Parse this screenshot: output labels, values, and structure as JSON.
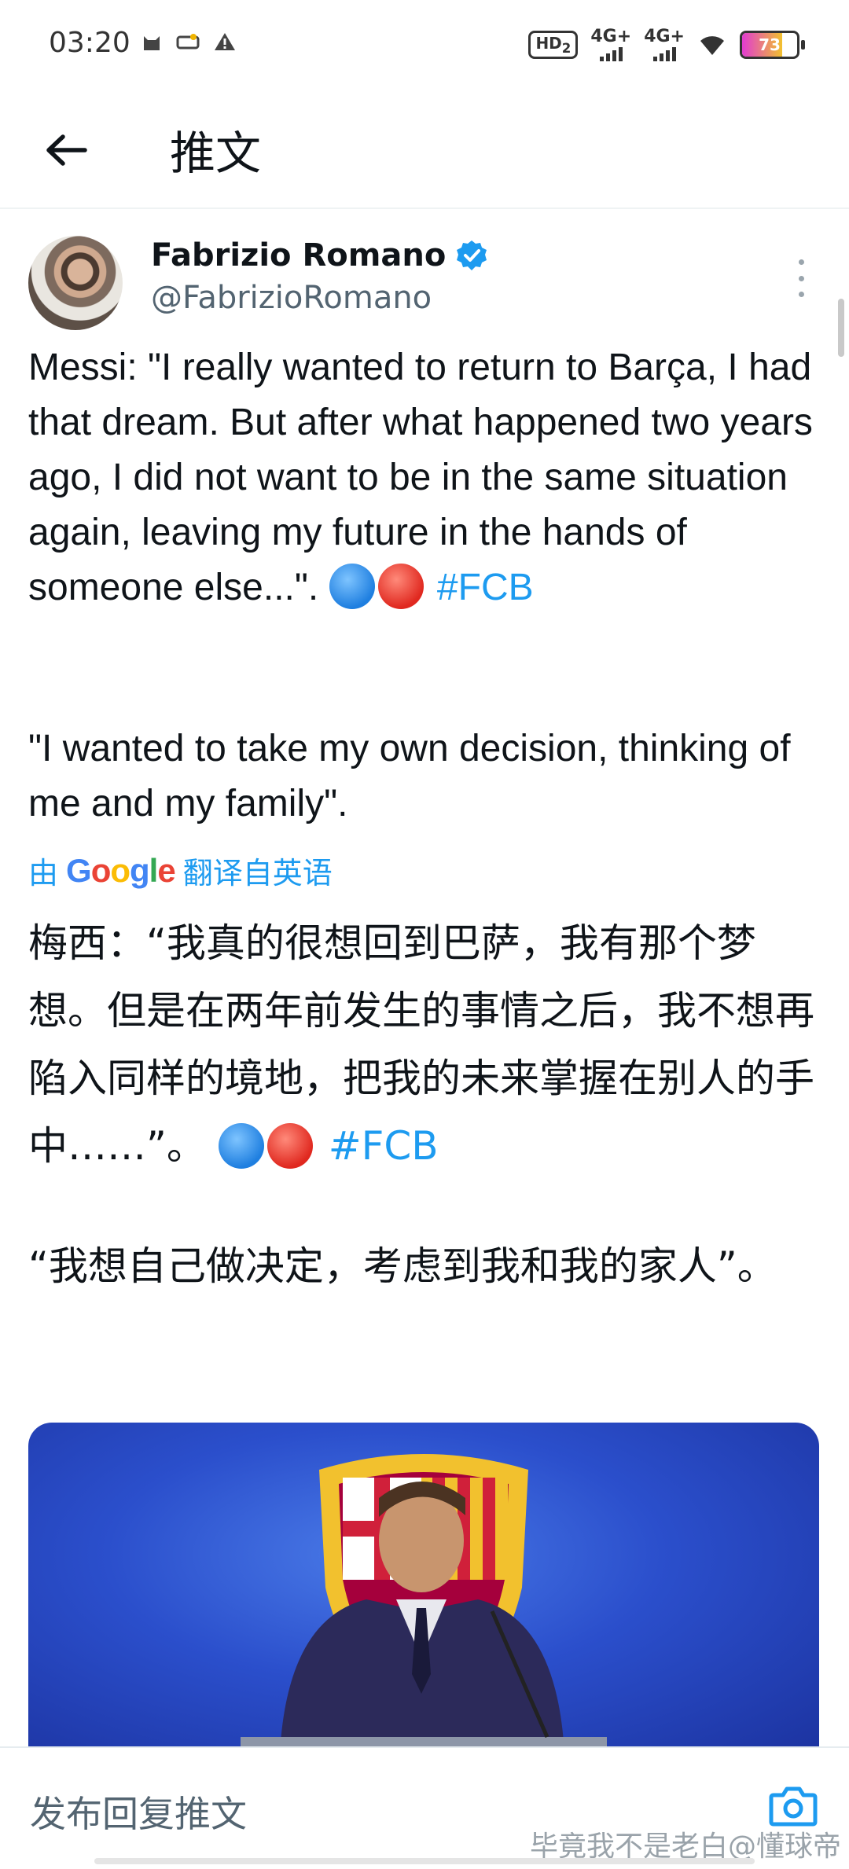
{
  "status_bar": {
    "time": "03:20",
    "hd_label": "HD",
    "hd_sub": "2",
    "net1": "4G+",
    "net2": "4G+",
    "battery": "73",
    "icons": [
      "cat-icon",
      "notification-icon",
      "warning-icon",
      "wifi-icon"
    ]
  },
  "header": {
    "title": "推文"
  },
  "tweet": {
    "author": "Fabrizio Romano",
    "handle": "@FabrizioRomano",
    "text_en_1": "Messi: \"I really wanted to return to Barça, I had that dream. But after what happened two years ago, I did not want to be in the same situation again, leaving my future in the hands of someone else...\".",
    "hashtag": "#FCB",
    "text_en_2": "\"I wanted to take my own decision, thinking of me and my family\".",
    "translate_prefix": "由",
    "translate_brand": "Google",
    "translate_suffix": "翻译自英语",
    "text_zh_1": "梅西：“我真的很想回到巴萨，我有那个梦想。但是在两年前发生的事情之后，我不想再陷入同样的境地，把我的未来掌握在别人的手中……”。",
    "text_zh_2": "“我想自己做决定，考虑到我和我的家人”。"
  },
  "reply_bar": {
    "placeholder": "发布回复推文"
  },
  "watermark": "毕竟我不是老白@懂球帝",
  "colors": {
    "accent": "#1d9bf0",
    "secondary_text": "#536471"
  }
}
